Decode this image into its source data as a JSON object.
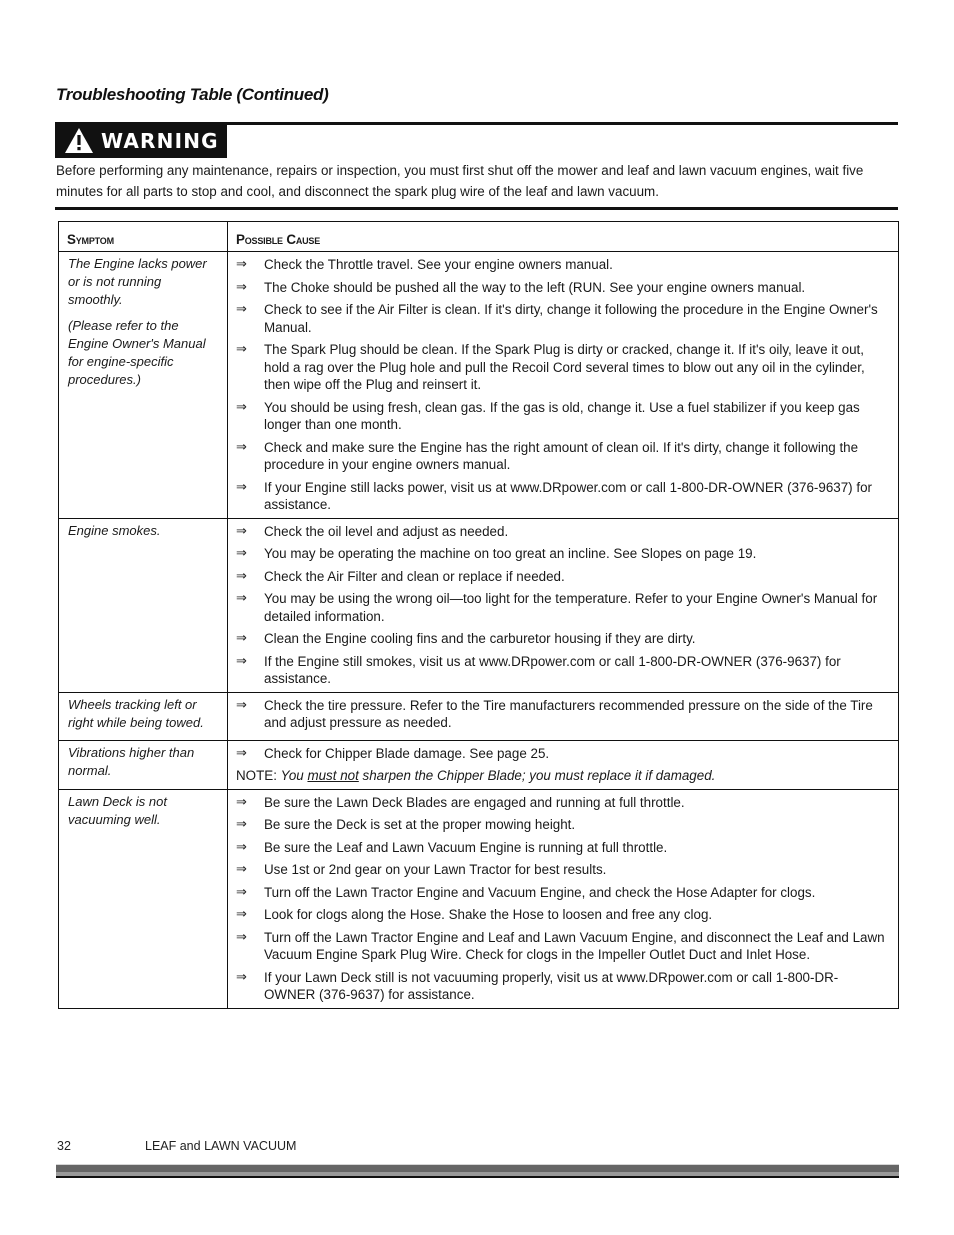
{
  "section_title": "Troubleshooting Table (Continued)",
  "warning": {
    "icon": "warning-triangle-icon",
    "label": "WARNING",
    "text": "Before performing any maintenance, repairs or inspection, you must first shut off the mower and leaf and lawn vacuum engines, wait five minutes for all parts to stop and cool, and disconnect the spark plug wire of the leaf and lawn vacuum."
  },
  "table": {
    "headers": [
      "Symptom",
      "Possible Cause"
    ],
    "bullet_icon": "⇒",
    "rows": [
      {
        "symptom": [
          "The Engine lacks power or is not running smoothly.",
          "(Please refer to the Engine Owner's Manual for engine-specific procedures.)"
        ],
        "causes": [
          "Check the Throttle travel.  See your engine owners manual.",
          "The Choke should be pushed all the way to the left (RUN.  See your engine owners manual.",
          "Check to see if the Air Filter is clean.  If it's dirty, change it following the procedure in the Engine Owner's Manual.",
          "The Spark Plug should be clean.  If the Spark Plug is dirty or cracked, change it.  If it's oily, leave it out, hold a rag over the Plug hole and pull the Recoil Cord several times to blow out any oil in the cylinder, then wipe off the Plug and reinsert it.",
          "You should be using fresh, clean gas.  If the gas is old, change it.  Use a fuel stabilizer if you keep gas longer than one month.",
          "Check and make sure the Engine has the right amount of clean oil.  If it's dirty, change it following the procedure in your engine owners manual.",
          "If your Engine still lacks power, visit us at www.DRpower.com or call 1-800-DR-OWNER (376-9637) for assistance."
        ]
      },
      {
        "symptom": [
          "Engine smokes."
        ],
        "causes": [
          "Check the oil level and adjust as needed.",
          "You may be operating the machine on too great an incline.  See Slopes on page 19.",
          "Check the Air Filter and clean or replace if needed.",
          "You may be using the wrong oil—too light for the temperature.  Refer to your Engine Owner's Manual for detailed information.",
          "Clean the Engine cooling fins and the carburetor housing if they are dirty.",
          "If the Engine still smokes, visit us at www.DRpower.com or call 1-800-DR-OWNER (376-9637) for assistance."
        ]
      },
      {
        "symptom": [
          "Wheels tracking left or right while being towed."
        ],
        "causes": [
          "Check the tire pressure.  Refer to the Tire manufacturers recommended pressure on the side of the Tire and adjust pressure as needed."
        ]
      },
      {
        "symptom": [
          "Vibrations higher than normal."
        ],
        "causes": [
          "Check for Chipper Blade damage.  See page 25."
        ],
        "note": {
          "prefix": "NOTE: ",
          "italic_before": "You ",
          "underlined": "must not",
          "italic_after": " sharpen the Chipper Blade; you must replace it if damaged."
        }
      },
      {
        "symptom": [
          "Lawn Deck is not vacuuming well."
        ],
        "causes": [
          "Be sure the Lawn Deck Blades are engaged and running at full throttle.",
          "Be sure the Deck is set at the proper mowing height.",
          "Be sure the Leaf and Lawn Vacuum Engine is running at full throttle.",
          "Use 1st or 2nd gear on your Lawn Tractor for best results.",
          "Turn off the Lawn Tractor Engine and Vacuum Engine, and check the Hose Adapter for clogs.",
          "Look for clogs along the Hose.  Shake the Hose to loosen and free any clog.",
          "Turn off the Lawn Tractor Engine and Leaf and Lawn Vacuum Engine, and disconnect the Leaf and Lawn Vacuum Engine Spark Plug Wire.  Check for clogs in the Impeller Outlet Duct and Inlet Hose.",
          "If your Lawn Deck still is not vacuuming properly, visit us at www.DRpower.com or call 1-800-DR-OWNER (376-9637) for assistance."
        ]
      }
    ]
  },
  "footer": {
    "page_number": "32",
    "product_title": "LEAF and LAWN VACUUM"
  }
}
